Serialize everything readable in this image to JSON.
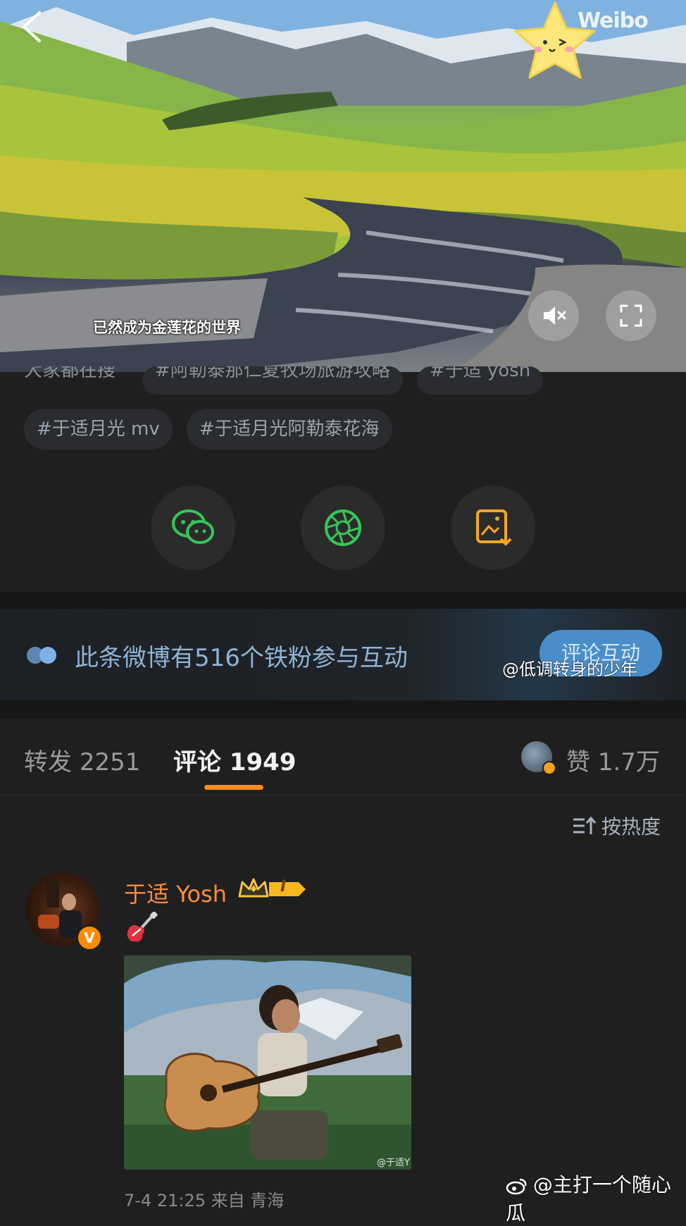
{
  "video": {
    "subtitle": "已然成为金莲花的世界",
    "watermark": "Weibo"
  },
  "tags": {
    "row1_partial": [
      "大家都在搜",
      "#阿勒泰那仁夏牧场旅游攻略",
      "#于适 yosh"
    ],
    "row2": [
      "#于适月光 mv",
      "#于适月光阿勒泰花海"
    ]
  },
  "share": {
    "icons": [
      "wechat-icon",
      "moments-icon",
      "save-image-icon"
    ]
  },
  "fans_banner": {
    "text": "此条微博有516个铁粉参与互动",
    "button": "评论互动",
    "credit": "@低调转身的少年"
  },
  "tabs": {
    "repost_label": "转发",
    "repost_count": "2251",
    "comment_label": "评论",
    "comment_count": "1949",
    "like_label": "赞",
    "like_count": "1.7万"
  },
  "sort": {
    "label": "按热度"
  },
  "comment": {
    "user": "于适 Yosh",
    "badge_level": "I",
    "content_emoji": "🎸",
    "photo_watermark": "@于适Y",
    "meta": "7-4 21:25 来自 青海"
  },
  "bottom_watermark": "@主打一个随心瓜",
  "colors": {
    "accent": "#ff8a1f",
    "background": "#1f1f1f",
    "fans_button": "#4a8ec9",
    "username": "#ff8c3a"
  }
}
